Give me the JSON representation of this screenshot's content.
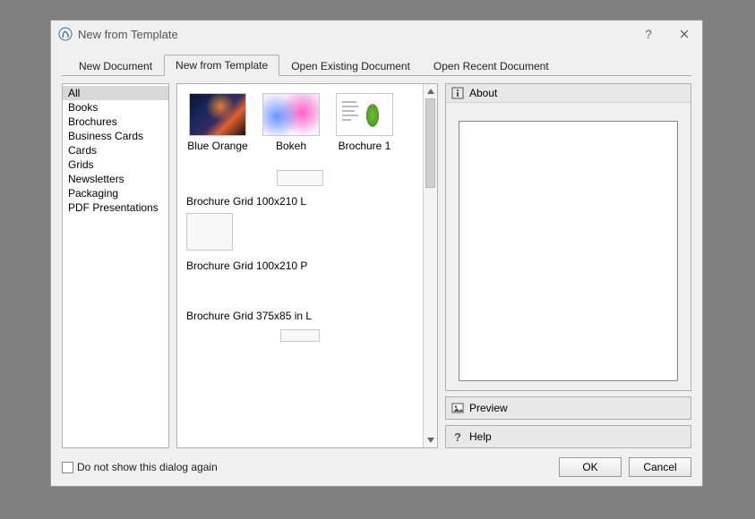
{
  "window": {
    "title": "New from Template",
    "help_tooltip": "?",
    "close_tooltip": "✕"
  },
  "tabs": [
    {
      "label": "New Document",
      "active": false
    },
    {
      "label": "New from Template",
      "active": true
    },
    {
      "label": "Open Existing Document",
      "active": false
    },
    {
      "label": "Open Recent Document",
      "active": false
    }
  ],
  "categories": [
    "All",
    "Books",
    "Brochures",
    "Business Cards",
    "Cards",
    "Grids",
    "Newsletters",
    "Packaging",
    "PDF Presentations"
  ],
  "selected_category_index": 0,
  "templates": {
    "row1": [
      {
        "label": "Blue Orange",
        "thumb": "blueorange"
      },
      {
        "label": "Bokeh",
        "thumb": "bokeh"
      },
      {
        "label": "Brochure 1",
        "thumb": "brochure1"
      }
    ],
    "long": [
      {
        "label": "Brochure Grid 100x210 L"
      },
      {
        "label": "Brochure Grid 100x210 P"
      },
      {
        "label": "Brochure Grid 375x85 in L"
      }
    ]
  },
  "about": {
    "header": "About"
  },
  "preview": {
    "header": "Preview"
  },
  "help": {
    "header": "Help"
  },
  "footer": {
    "checkbox_label": "Do not show this dialog again",
    "ok": "OK",
    "cancel": "Cancel"
  }
}
